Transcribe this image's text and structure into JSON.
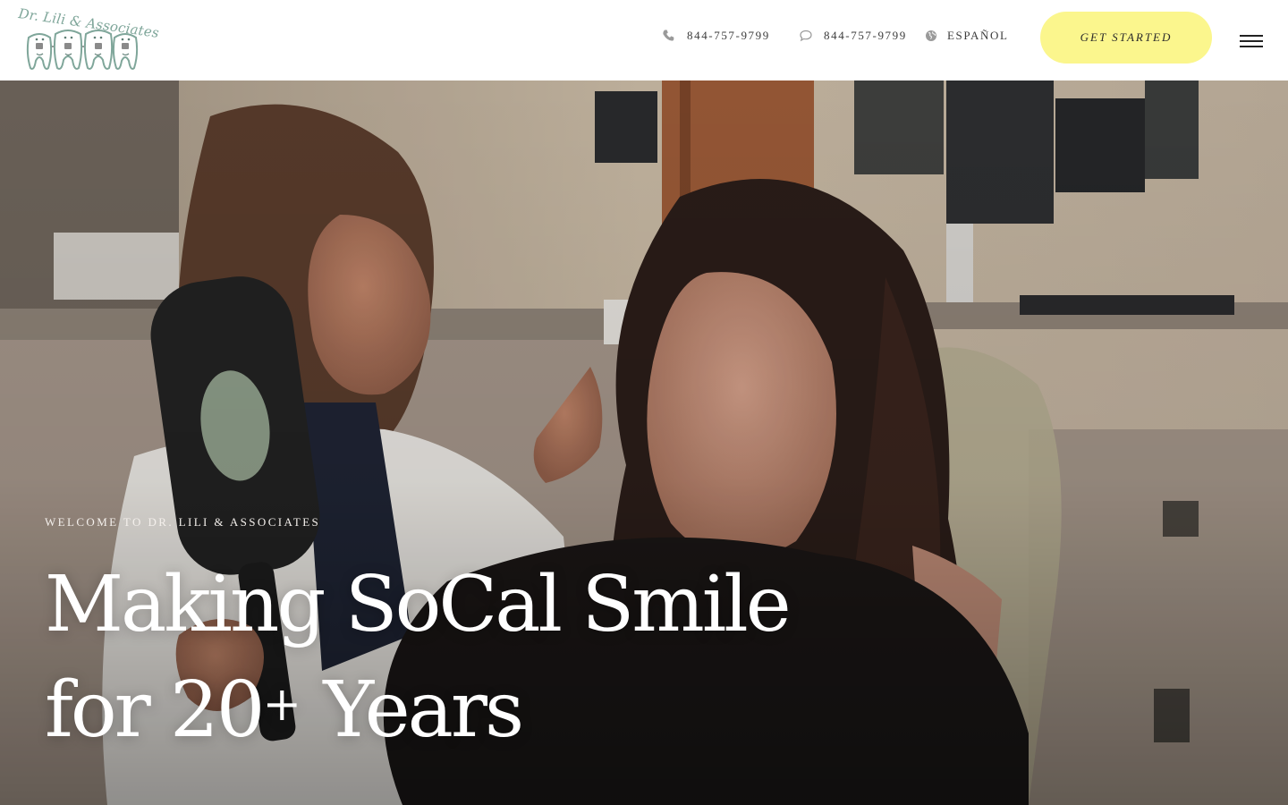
{
  "header": {
    "logo_text": "Dr. Lili & Associates",
    "phone_label": "844-757-9799",
    "text_label": "844-757-9799",
    "language_label": "ESPAÑOL",
    "cta_label": "GET STARTED"
  },
  "hero": {
    "eyebrow": "WELCOME TO DR. LILI & ASSOCIATES",
    "headline_line1": "Making SoCal Smile",
    "headline_line2_prefix": "for 20",
    "headline_plus": "+",
    "headline_line2_suffix": " Years"
  },
  "icons": {
    "phone": "phone-icon",
    "text": "speech-bubble-icon",
    "language": "globe-icon",
    "menu": "hamburger-menu-icon"
  },
  "colors": {
    "cta_background": "#fbf68d",
    "logo_accent": "#7fa69a",
    "hero_text": "#ffffff"
  }
}
